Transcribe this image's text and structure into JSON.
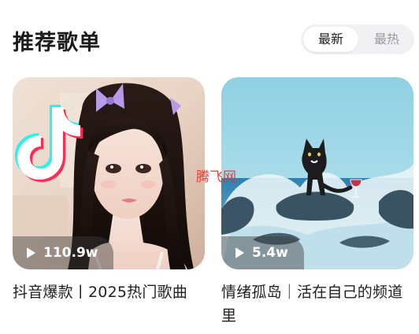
{
  "section": {
    "title": "推荐歌单"
  },
  "sort": {
    "options": [
      "最新",
      "最热"
    ],
    "active": "最新"
  },
  "playlists": [
    {
      "title": "抖音爆款丨2025热门歌曲",
      "play_count": "110.9w",
      "cover_icon": "tiktok-logo-icon"
    },
    {
      "title": "情绪孤岛｜活在自己的频道里",
      "play_count": "5.4w",
      "cover_icon": "cat-on-rock-painting"
    }
  ],
  "watermark": "腾飞网",
  "colors": {
    "accent_text": "#1f1f1f",
    "muted_text": "#9a9a9a",
    "watermark": "#e8332d",
    "toggle_bg": "#f1f1f3"
  }
}
